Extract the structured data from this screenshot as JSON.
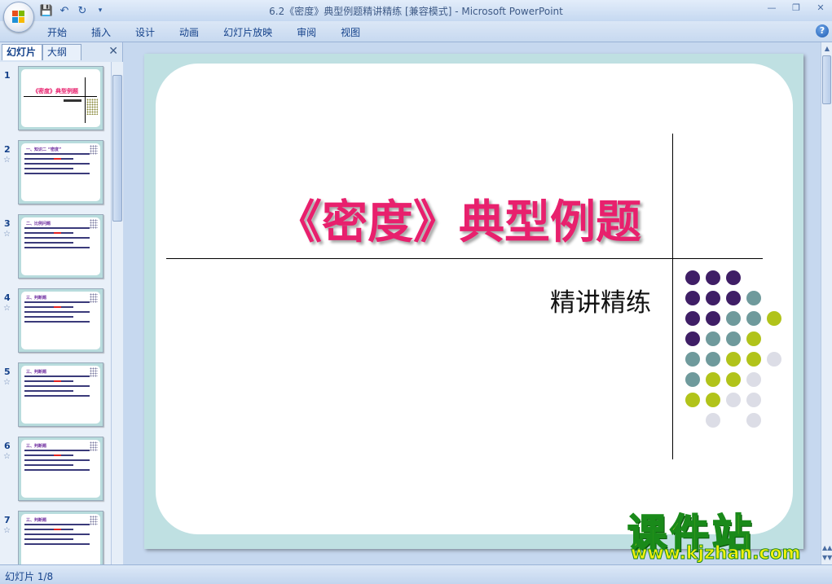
{
  "window": {
    "title": "6.2《密度》典型例题精讲精练 [兼容模式] - Microsoft PowerPoint"
  },
  "quick_access": {
    "icons": [
      "save-icon",
      "undo-icon",
      "redo-icon",
      "customize-icon"
    ]
  },
  "ribbon": {
    "tabs": [
      "开始",
      "插入",
      "设计",
      "动画",
      "幻灯片放映",
      "审阅",
      "视图"
    ]
  },
  "left_pane": {
    "tab_slides": "幻灯片",
    "tab_outline": "大纲",
    "thumbnails": [
      {
        "num": "1",
        "title": "《密度》典型例题",
        "selected": true
      },
      {
        "num": "2",
        "title": "一、知识二 “密度”"
      },
      {
        "num": "3",
        "title": "二、比例问题"
      },
      {
        "num": "4",
        "title": "三、判断题"
      },
      {
        "num": "5",
        "title": "三、判断题"
      },
      {
        "num": "6",
        "title": "三、判断题"
      },
      {
        "num": "7",
        "title": "三、判断题"
      }
    ]
  },
  "slide": {
    "title": "《密度》典型例题",
    "subtitle": "精讲精练",
    "colors": {
      "frame": "#bfe0e2",
      "title": "#e8206d",
      "dot_purple": "#3f1e66",
      "dot_teal": "#6f9a9c",
      "dot_lime": "#b1c31a",
      "dot_gray": "#dcdde6"
    }
  },
  "statusbar": {
    "text": "幻灯片 1/8"
  },
  "watermark": {
    "main": "课件站",
    "url": "www.kjzhan.com"
  }
}
